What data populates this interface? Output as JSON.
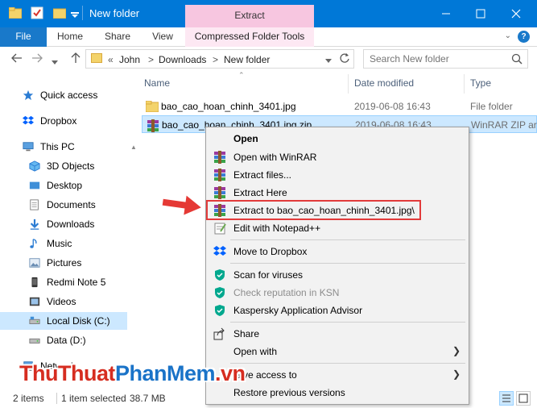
{
  "window": {
    "title": "New folder",
    "context_tab_label": "Extract"
  },
  "ribbon": {
    "tabs": [
      "File",
      "Home",
      "Share",
      "View"
    ],
    "contextual_tab": "Compressed Folder Tools"
  },
  "address": {
    "overflow": "«",
    "segments": [
      "John",
      "Downloads",
      "New folder"
    ],
    "separator": ">"
  },
  "search": {
    "placeholder": "Search New folder"
  },
  "sidebar": {
    "items": [
      {
        "label": "Quick access",
        "icon": "star-icon"
      },
      {
        "label": "Dropbox",
        "icon": "dropbox-icon"
      },
      {
        "label": "This PC",
        "icon": "monitor-icon"
      },
      {
        "label": "3D Objects",
        "icon": "cube-icon"
      },
      {
        "label": "Desktop",
        "icon": "desktop-icon"
      },
      {
        "label": "Documents",
        "icon": "document-icon"
      },
      {
        "label": "Downloads",
        "icon": "download-icon"
      },
      {
        "label": "Music",
        "icon": "music-icon"
      },
      {
        "label": "Pictures",
        "icon": "pictures-icon"
      },
      {
        "label": "Redmi Note 5",
        "icon": "phone-icon"
      },
      {
        "label": "Videos",
        "icon": "video-icon"
      },
      {
        "label": "Local Disk (C:)",
        "icon": "drive-icon"
      },
      {
        "label": "Data (D:)",
        "icon": "drive-icon"
      },
      {
        "label": "Network",
        "icon": "network-icon"
      }
    ]
  },
  "file_list": {
    "columns": [
      "Name",
      "Date modified",
      "Type"
    ],
    "rows": [
      {
        "name": "bao_cao_hoan_chinh_3401.jpg",
        "date": "2019-06-08 16:43",
        "type": "File folder"
      },
      {
        "name": "bao_cao_hoan_chinh_3401.jpg.zip",
        "date": "2019-06-08 16:43",
        "type": "WinRAR ZIP arc"
      }
    ]
  },
  "context_menu": {
    "items": [
      {
        "label": "Open",
        "icon": "none"
      },
      {
        "label": "Open with WinRAR",
        "icon": "winrar-icon"
      },
      {
        "label": "Extract files...",
        "icon": "winrar-icon"
      },
      {
        "label": "Extract Here",
        "icon": "winrar-icon"
      },
      {
        "label": "Extract to bao_cao_hoan_chinh_3401.jpg\\",
        "icon": "winrar-icon"
      },
      {
        "label": "Edit with Notepad++",
        "icon": "notepad-icon"
      },
      {
        "label": "Move to Dropbox",
        "icon": "dropbox-icon"
      },
      {
        "label": "Scan for viruses",
        "icon": "kaspersky-icon"
      },
      {
        "label": "Check reputation in KSN",
        "icon": "kaspersky-icon"
      },
      {
        "label": "Kaspersky Application Advisor",
        "icon": "kaspersky-icon"
      },
      {
        "label": "Share",
        "icon": "share-icon"
      },
      {
        "label": "Open with",
        "icon": "none"
      },
      {
        "label": "Give access to",
        "icon": "none"
      },
      {
        "label": "Restore previous versions",
        "icon": "none"
      }
    ]
  },
  "status": {
    "count": "2 items",
    "selection": "1 item selected",
    "size": "38.7 MB"
  },
  "watermark": {
    "part1": "ThuThuat",
    "part2": "PhanMem",
    "part3": ".vn"
  },
  "colors": {
    "titlebar": "#0078d7",
    "selection": "#cce8ff",
    "highlight": "#e23b3b",
    "context_tab": "#f7c6e0"
  }
}
